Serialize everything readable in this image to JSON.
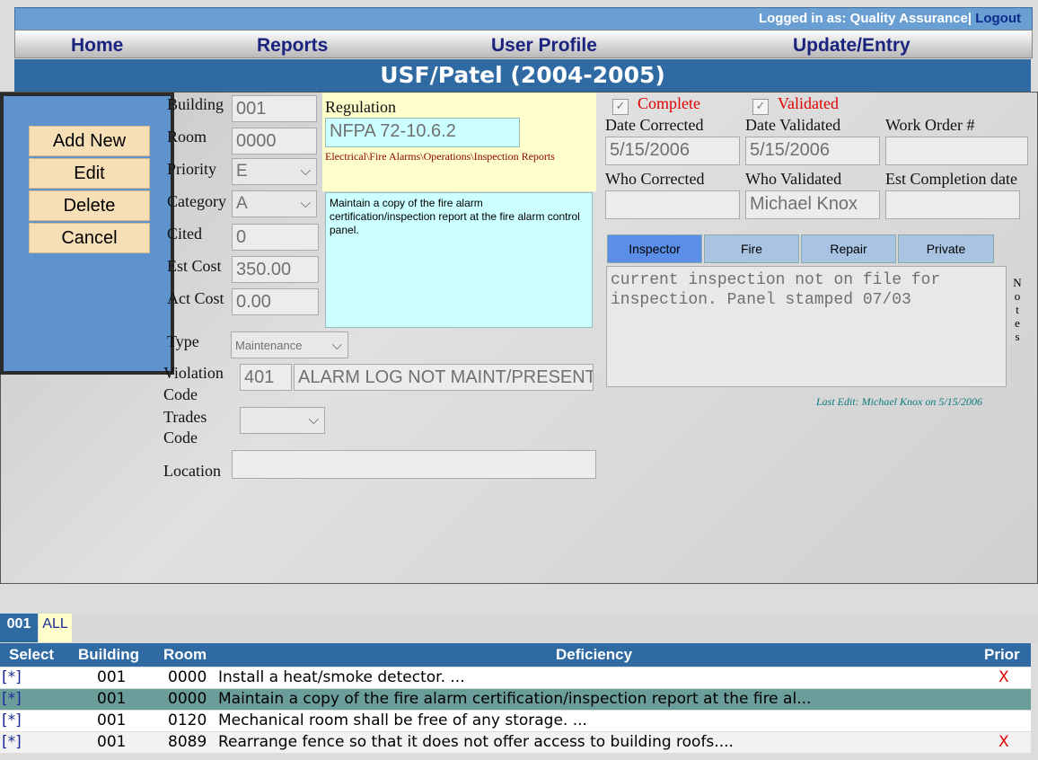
{
  "header": {
    "login_text": "Logged in as: Quality Assurance|",
    "logout_label": "Logout"
  },
  "nav": {
    "home": "Home",
    "reports": "Reports",
    "user_profile": "User Profile",
    "update_entry": "Update/Entry"
  },
  "page_title": "USF/Patel (2004-2005)",
  "actions": {
    "add_new": "Add New",
    "edit": "Edit",
    "delete": "Delete",
    "cancel": "Cancel"
  },
  "form": {
    "building_label": "Building",
    "building_value": "001",
    "room_label": "Room",
    "room_value": "0000",
    "priority_label": "Priority",
    "priority_value": "E",
    "category_label": "Category",
    "category_value": "A",
    "cited_label": "Cited",
    "cited_value": "0",
    "est_cost_label": "Est Cost",
    "est_cost_value": "350.00",
    "act_cost_label": "Act Cost",
    "act_cost_value": "0.00",
    "type_label": "Type",
    "type_value": "Maintenance",
    "violation_label_1": "Violation",
    "violation_label_2": "Code",
    "violation_code": "401",
    "violation_desc": "ALARM LOG NOT MAINT/PRESENT",
    "trades_label_1": "Trades",
    "trades_label_2": "Code",
    "trades_value": "",
    "location_label": "Location",
    "location_value": "",
    "regulation_label": "Regulation",
    "regulation_value": "NFPA 72-10.6.2",
    "regulation_path": "Electrical\\Fire Alarms\\Operations\\Inspection Reports",
    "deficiency_text": "Maintain a copy of the fire alarm certification/inspection report at the fire alarm control panel."
  },
  "status": {
    "complete_label": "Complete",
    "validated_label": "Validated",
    "check_mark": "✓",
    "date_corrected_label": "Date Corrected",
    "date_corrected_value": "5/15/2006",
    "date_validated_label": "Date Validated",
    "date_validated_value": "5/15/2006",
    "work_order_label": "Work Order #",
    "work_order_value": "",
    "who_corrected_label": "Who Corrected",
    "who_corrected_value": "",
    "who_validated_label": "Who Validated",
    "who_validated_value": "Michael Knox",
    "est_completion_label": "Est Completion date",
    "est_completion_value": ""
  },
  "notes": {
    "tabs": [
      "Inspector",
      "Fire",
      "Repair",
      "Private"
    ],
    "text": "current inspection not on file for inspection.  Panel stamped 07/03",
    "side_label": [
      "N",
      "o",
      "t",
      "e",
      "s"
    ],
    "last_edit": "Last Edit: Michael Knox on 5/15/2006"
  },
  "grid": {
    "tabs": [
      "001",
      "ALL"
    ],
    "headers": {
      "select": "Select",
      "building": "Building",
      "room": "Room",
      "deficiency": "Deficiency",
      "prior": "Prior"
    },
    "rows": [
      {
        "select": "[*]",
        "building": "001",
        "room": "0000",
        "deficiency": "Install a heat/smoke detector. ...",
        "prior": "X"
      },
      {
        "select": "[*]",
        "building": "001",
        "room": "0000",
        "deficiency": "Maintain a copy of the fire alarm certification/inspection report at the fire al...",
        "prior": ""
      },
      {
        "select": "[*]",
        "building": "001",
        "room": "0120",
        "deficiency": "Mechanical room shall be free of any storage. ...",
        "prior": ""
      },
      {
        "select": "[*]",
        "building": "001",
        "room": "8089",
        "deficiency": "Rearrange fence so that it does not offer access to building roofs....",
        "prior": "X"
      }
    ]
  },
  "colors": {
    "nav_text": "#1a237e",
    "title_bar": "#2f6aa3",
    "selected_row": "#6b9e9a",
    "alert_red": "#e00000"
  }
}
